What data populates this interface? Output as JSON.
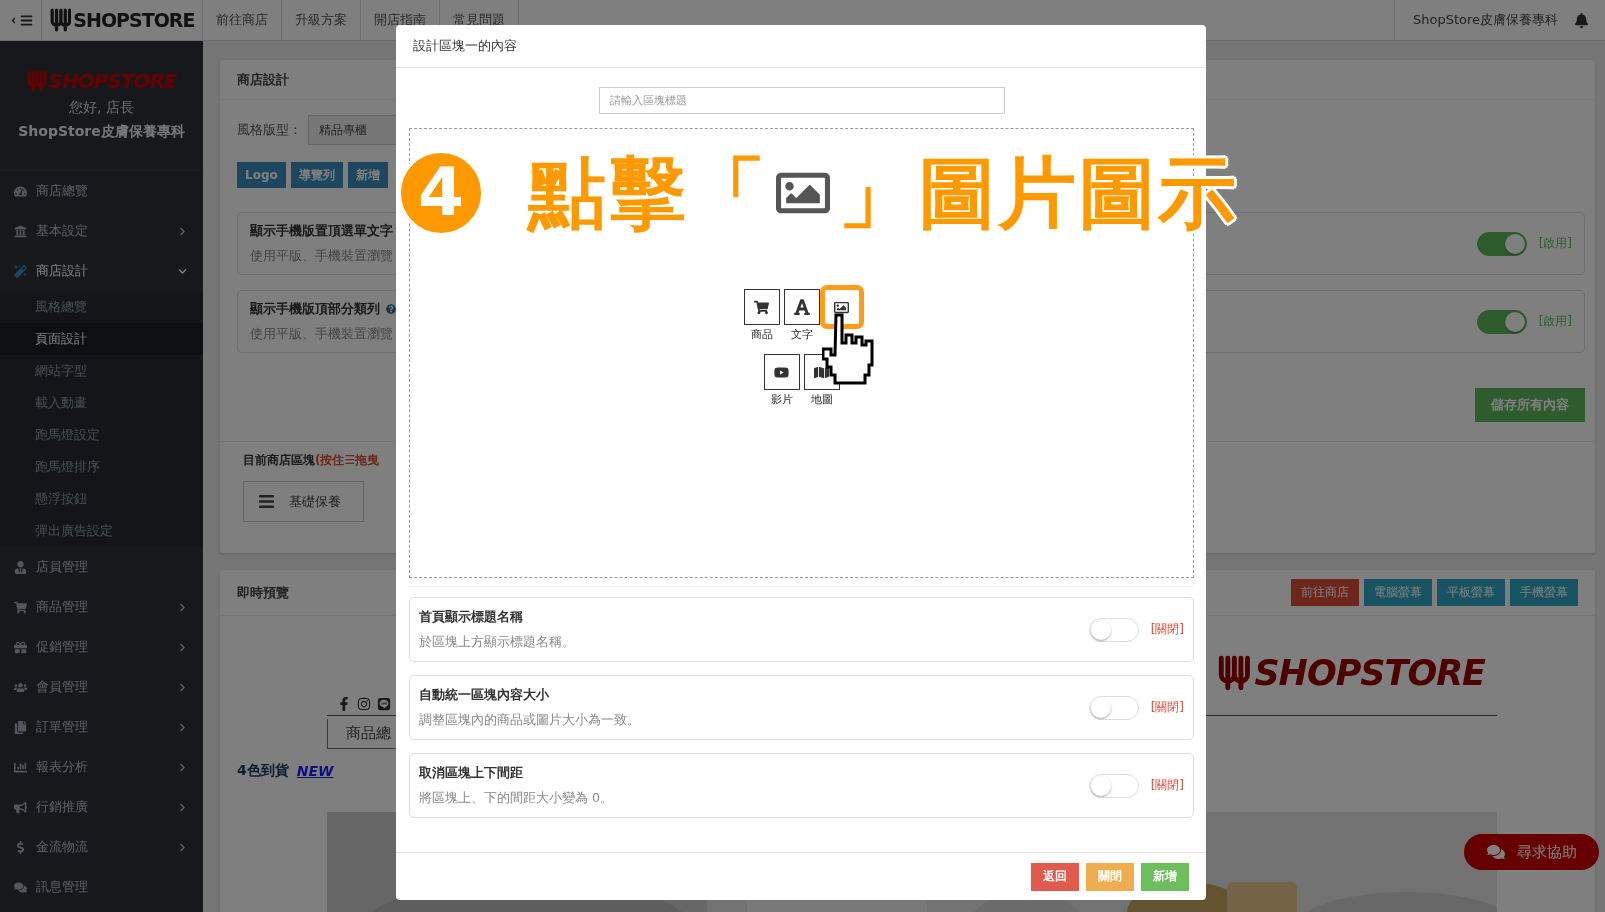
{
  "topbar": {
    "logo": "SHOPSTORE",
    "nav": [
      "前往商店",
      "升級方案",
      "開店指南",
      "常見問題"
    ],
    "store_name": "ShopStore皮膚保養專科"
  },
  "sidebar": {
    "logo": "SHOPSTORE",
    "greeting": "您好, 店長",
    "store": "ShopStore皮膚保養專科",
    "items": [
      {
        "label": "商店總覽",
        "expandable": false,
        "expanded": false
      },
      {
        "label": "基本設定",
        "expandable": true,
        "expanded": false
      },
      {
        "label": "商店設計",
        "expandable": true,
        "expanded": true,
        "children": [
          {
            "label": "風格總覽",
            "selected": false
          },
          {
            "label": "頁面設計",
            "selected": true
          },
          {
            "label": "網站字型",
            "selected": false
          },
          {
            "label": "載入動畫",
            "selected": false
          },
          {
            "label": "跑馬燈設定",
            "selected": false
          },
          {
            "label": "跑馬燈排序",
            "selected": false
          },
          {
            "label": "懸浮按鈕",
            "selected": false
          },
          {
            "label": "彈出廣告設定",
            "selected": false
          }
        ]
      },
      {
        "label": "店員管理",
        "expandable": false,
        "expanded": false
      },
      {
        "label": "商品管理",
        "expandable": true,
        "expanded": false
      },
      {
        "label": "促銷管理",
        "expandable": true,
        "expanded": false
      },
      {
        "label": "會員管理",
        "expandable": true,
        "expanded": false
      },
      {
        "label": "訂單管理",
        "expandable": true,
        "expanded": false
      },
      {
        "label": "報表分析",
        "expandable": true,
        "expanded": false
      },
      {
        "label": "行銷推廣",
        "expandable": true,
        "expanded": false
      },
      {
        "label": "金流物流",
        "expandable": true,
        "expanded": false
      },
      {
        "label": "訊息管理",
        "expandable": false,
        "expanded": false
      }
    ]
  },
  "design_panel": {
    "title": "商店設計",
    "style_label": "風格版型：",
    "style_value": "精品專櫃",
    "buttons": [
      "Logo",
      "導覽列",
      "新增"
    ],
    "settings": [
      {
        "title": "顯示手機版置頂選單文字",
        "description": "使用平版、手機裝置瀏覽",
        "help": false,
        "on": true,
        "status": "[啟用]"
      },
      {
        "title": "顯示手機版頂部分類列",
        "description": "使用平版、手機裝置瀏覽",
        "help": true,
        "on": true,
        "status": "[啟用]"
      }
    ],
    "save": "儲存所有內容",
    "blocks_label": "目前商店區塊",
    "blocks_hint": "(按住☰拖曳",
    "blocks": [
      "基礎保養"
    ]
  },
  "preview": {
    "title": "即時預覽",
    "buttons": [
      {
        "label": "前往商店",
        "kind": "danger"
      },
      {
        "label": "電腦螢幕",
        "kind": "info"
      },
      {
        "label": "平板螢幕",
        "kind": "info"
      },
      {
        "label": "手機螢幕",
        "kind": "info"
      }
    ],
    "logo": "SHOPSTORE",
    "tab": "商品總",
    "headline": "4色到貨",
    "badge": "NEW"
  },
  "help_button": "尋求協助",
  "modal": {
    "title": "設計區塊一的內容",
    "title_placeholder": "請輸入區塊標題",
    "content_types": [
      {
        "label": "商品",
        "selected": false
      },
      {
        "label": "文字",
        "selected": false
      },
      {
        "selected": true
      },
      {
        "label": "影片",
        "selected": false
      },
      {
        "label": "地圖",
        "selected": false
      }
    ],
    "options": [
      {
        "title": "首頁顯示標題名稱",
        "description": "於區塊上方顯示標題名稱。",
        "on": false,
        "status": "[關閉]"
      },
      {
        "title": "自動統一區塊內容大小",
        "description": "調整區塊內的商品或圖片大小為一致。",
        "on": false,
        "status": "[關閉]"
      },
      {
        "title": "取消區塊上下間距",
        "description": "將區塊上、下的間距大小變為 0。",
        "on": false,
        "status": "[關閉]"
      }
    ],
    "buttons": [
      {
        "label": "返回",
        "kind": "back"
      },
      {
        "label": "關閉",
        "kind": "close"
      },
      {
        "label": "新增",
        "kind": "add"
      }
    ]
  },
  "annotation": {
    "step": "4",
    "before": "點擊「",
    "after": "」圖片圖示"
  }
}
